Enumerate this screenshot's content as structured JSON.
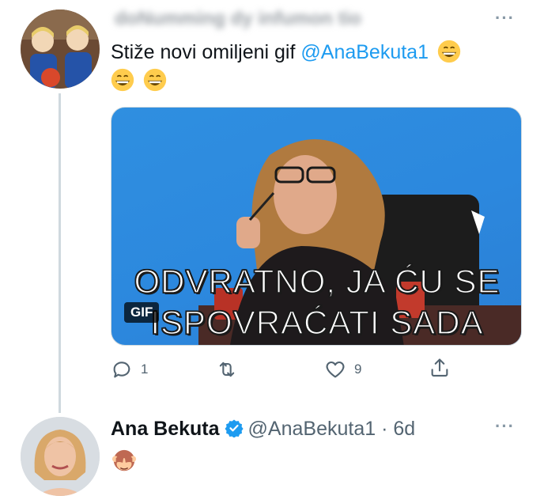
{
  "thread": {
    "tweet1": {
      "display_name": "doNumming dy infumon tio",
      "text_before_mention": "Stiže novi omiljeni gif ",
      "mention": "@AnaBekuta1",
      "more_label": "···",
      "media": {
        "badge": "GIF",
        "caption_line1": "ODVRATNO, JA ĆU SE",
        "caption_line2": "ISPOVRAĆATI SADA",
        "background_color": "#2c88de"
      },
      "actions": {
        "reply_count": "1",
        "retweet_count": "",
        "like_count": "9"
      }
    },
    "tweet2": {
      "display_name": "Ana Bekuta",
      "handle_time": "@AnaBekuta1 · 6d",
      "more_label": "···"
    }
  },
  "colors": {
    "link": "#1d9bf0",
    "secondary_text": "#536471",
    "thread_line": "#cfd9de",
    "verified": "#1d9bf0"
  },
  "icons": [
    "reply-icon",
    "retweet-icon",
    "like-icon",
    "share-icon",
    "verified-badge-icon",
    "grinning-emoji-icon",
    "see-no-evil-monkey-emoji-icon"
  ]
}
